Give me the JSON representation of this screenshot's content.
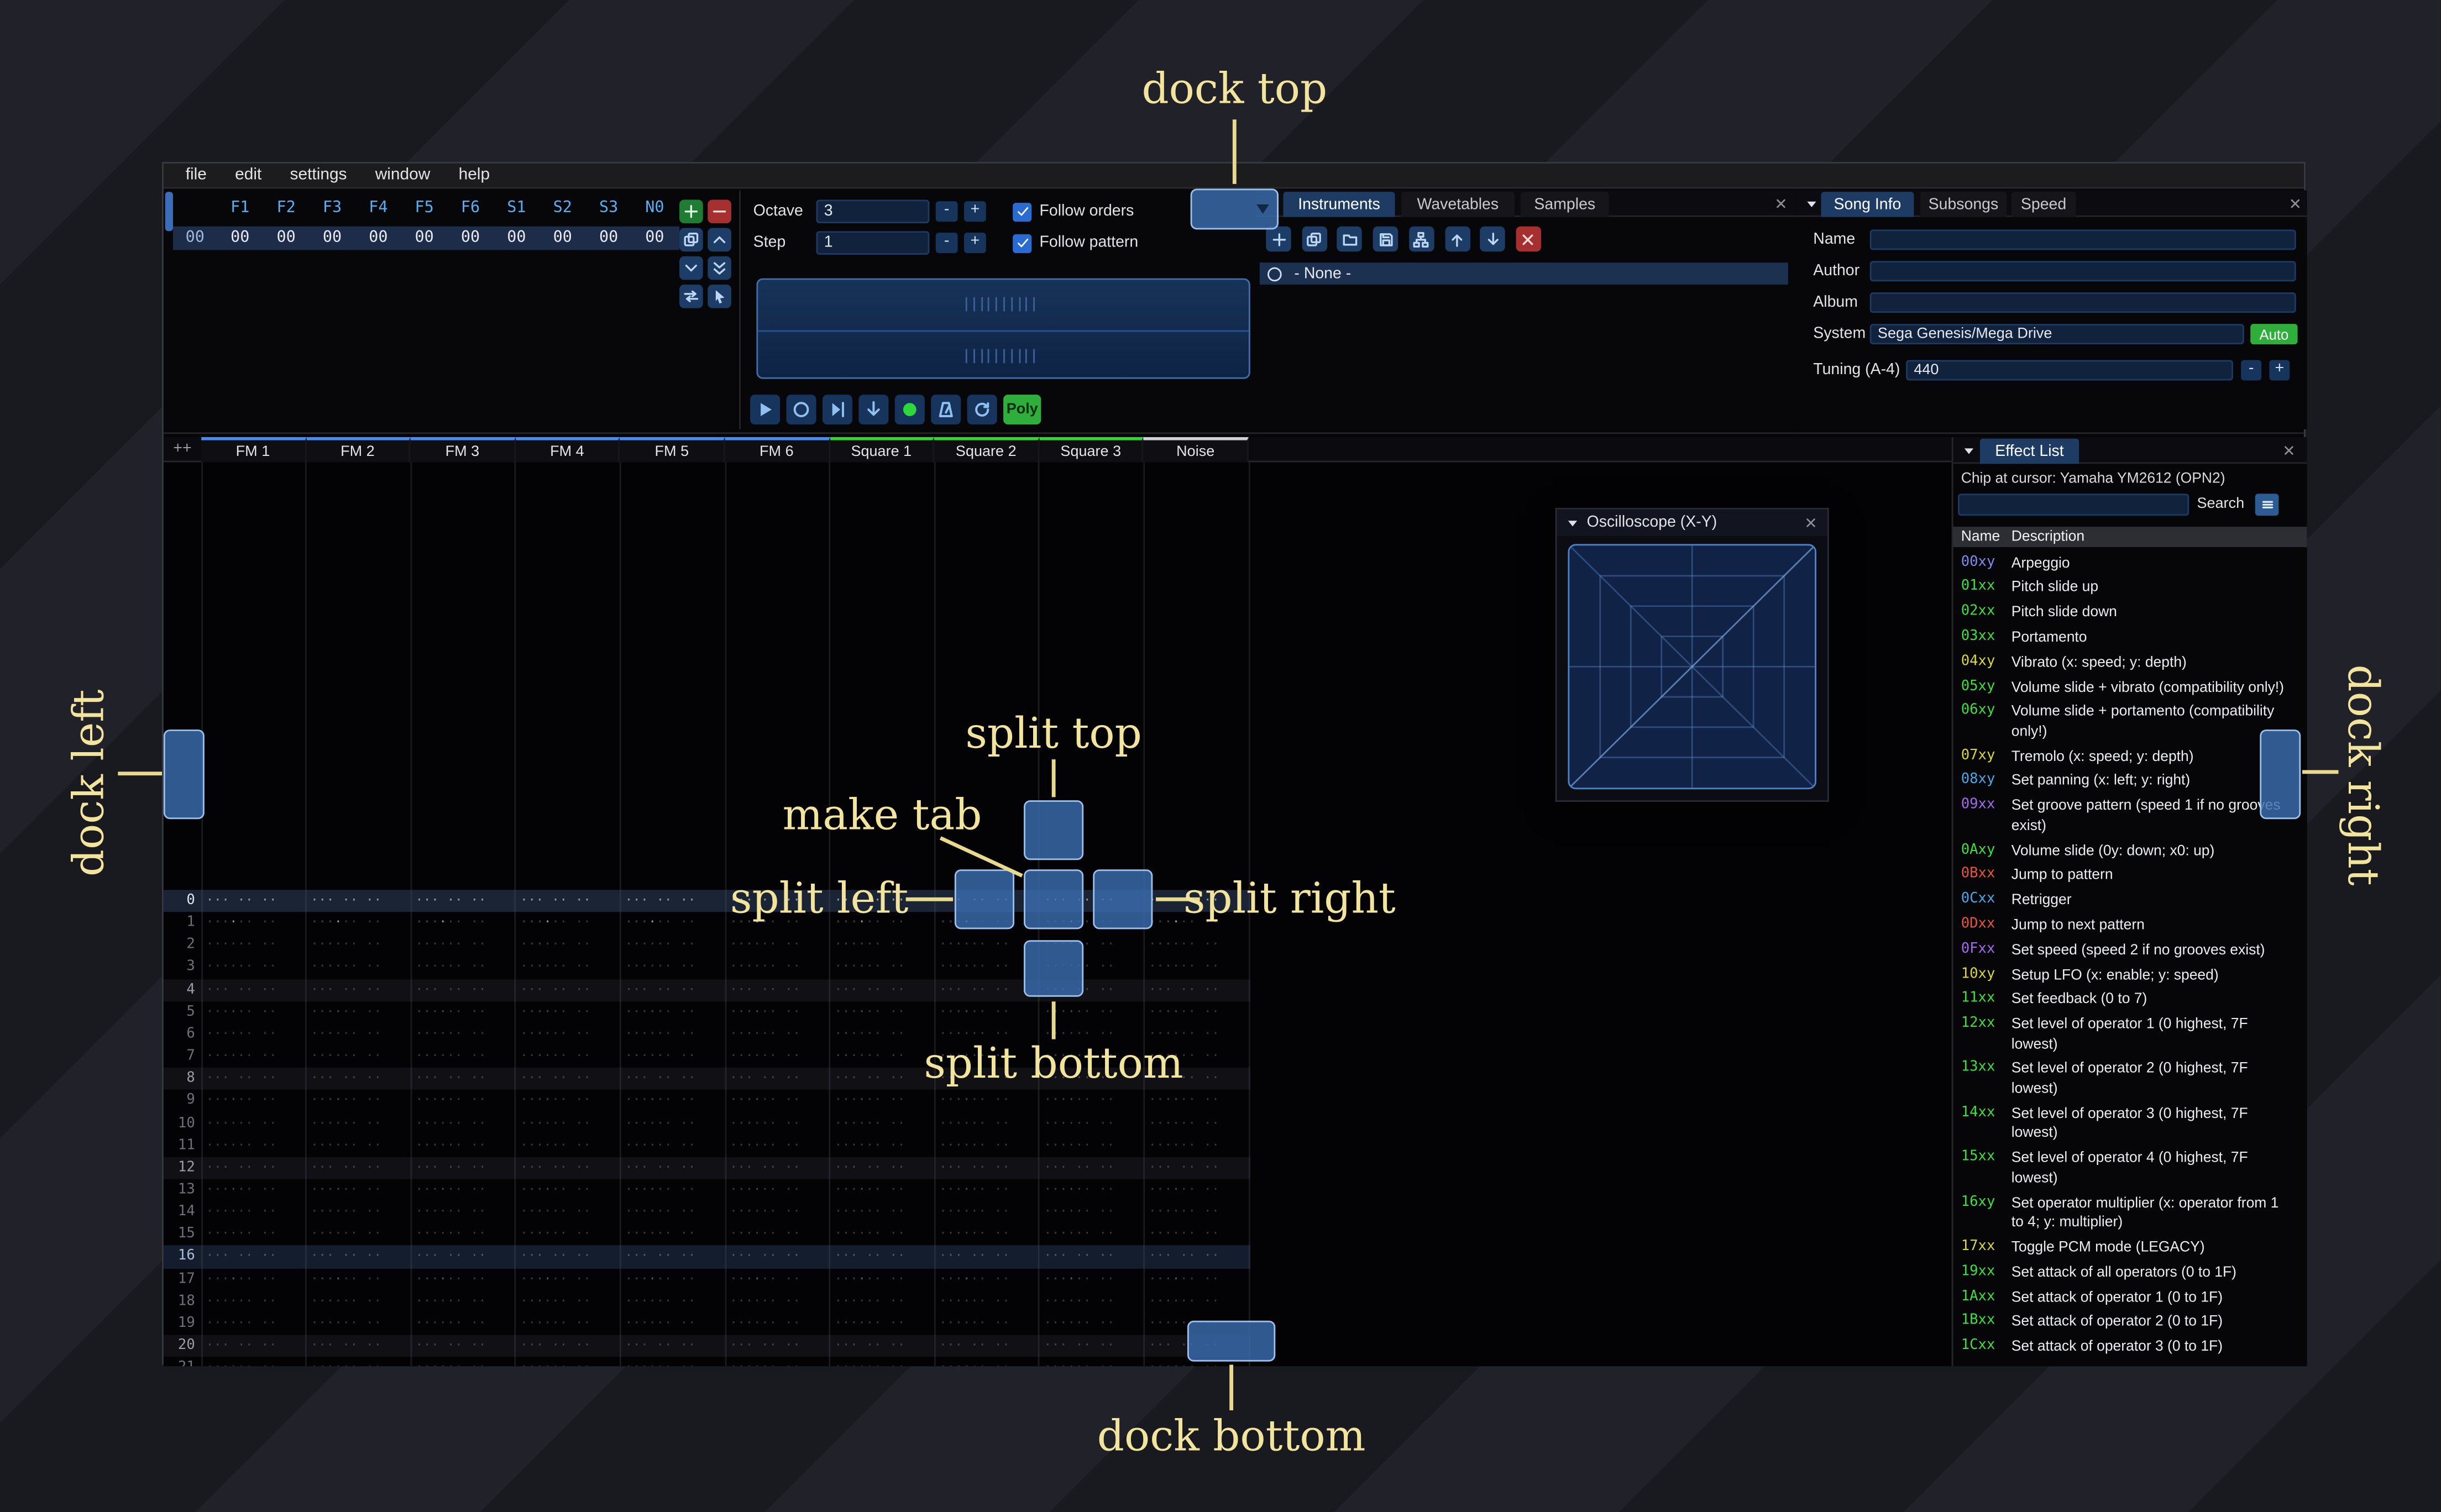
{
  "menu": [
    "file",
    "edit",
    "settings",
    "window",
    "help"
  ],
  "orders": {
    "channel_headers": [
      "F1",
      "F2",
      "F3",
      "F4",
      "F5",
      "F6",
      "S1",
      "S2",
      "S3",
      "N0"
    ],
    "rows": [
      {
        "index": "00",
        "values": [
          "00",
          "00",
          "00",
          "00",
          "00",
          "00",
          "00",
          "00",
          "00",
          "00"
        ]
      }
    ],
    "buttons": [
      {
        "name": "add-order",
        "icon": "plus",
        "style": "green"
      },
      {
        "name": "remove-order",
        "icon": "minus",
        "style": "red"
      },
      {
        "name": "duplicate-order",
        "icon": "copy",
        "style": "blue"
      },
      {
        "name": "move-order-up",
        "icon": "chevron-up",
        "style": "blue"
      },
      {
        "name": "move-order-down",
        "icon": "chevron-down",
        "style": "blue"
      },
      {
        "name": "duplicate-order-to-end",
        "icon": "double-chevron-down",
        "style": "blue"
      },
      {
        "name": "order-change-all",
        "icon": "swap",
        "style": "blue"
      },
      {
        "name": "order-edit-mode",
        "icon": "pointer",
        "style": "blue"
      }
    ]
  },
  "transport": {
    "octave_label": "Octave",
    "octave_value": "3",
    "step_label": "Step",
    "step_value": "1",
    "minus_label": "-",
    "plus_label": "+",
    "follow_orders_label": "Follow orders",
    "follow_pattern_label": "Follow pattern",
    "buttons": [
      {
        "name": "play",
        "icon": "play"
      },
      {
        "name": "play-pattern",
        "icon": "circle-play"
      },
      {
        "name": "play-from-cursor",
        "icon": "step"
      },
      {
        "name": "step-one-row",
        "icon": "arrow-down"
      },
      {
        "name": "edit-record-toggle",
        "icon": "record",
        "style": "record"
      },
      {
        "name": "metronome",
        "icon": "metronome"
      },
      {
        "name": "repeat-pattern",
        "icon": "loop"
      }
    ],
    "poly_label": "Poly"
  },
  "instruments": {
    "tabs": [
      {
        "label": "Instruments",
        "active": true
      },
      {
        "label": "Wavetables",
        "active": false
      },
      {
        "label": "Samples",
        "active": false
      }
    ],
    "toolbar": [
      {
        "name": "add-instrument",
        "icon": "plus",
        "style": "blue"
      },
      {
        "name": "duplicate-instrument",
        "icon": "copy",
        "style": "blue"
      },
      {
        "name": "open-instrument",
        "icon": "folder-open",
        "style": "blue"
      },
      {
        "name": "save-instrument",
        "icon": "save",
        "style": "blue"
      },
      {
        "name": "toggle-folders",
        "icon": "sitemap",
        "style": "blue"
      },
      {
        "name": "move-instrument-up",
        "icon": "arrow-up",
        "style": "blue"
      },
      {
        "name": "move-instrument-down",
        "icon": "arrow-down",
        "style": "blue"
      },
      {
        "name": "delete-instrument",
        "icon": "x",
        "style": "red"
      }
    ],
    "items": [
      {
        "label": "- None -",
        "selected": true
      }
    ]
  },
  "song_info": {
    "tabs": [
      {
        "label": "Song Info",
        "active": true
      },
      {
        "label": "Subsongs",
        "active": false
      },
      {
        "label": "Speed",
        "active": false
      }
    ],
    "fields": [
      {
        "label": "Name",
        "value": ""
      },
      {
        "label": "Author",
        "value": ""
      },
      {
        "label": "Album",
        "value": ""
      }
    ],
    "system_label": "System",
    "system_value": "Sega Genesis/Mega Drive",
    "auto_label": "Auto",
    "tuning_label": "Tuning (A-4)",
    "tuning_value": "440"
  },
  "pattern": {
    "expand_label": "++",
    "channels": [
      {
        "label": "FM 1",
        "type": "fm"
      },
      {
        "label": "FM 2",
        "type": "fm"
      },
      {
        "label": "FM 3",
        "type": "fm"
      },
      {
        "label": "FM 4",
        "type": "fm"
      },
      {
        "label": "FM 5",
        "type": "fm"
      },
      {
        "label": "FM 6",
        "type": "fm"
      },
      {
        "label": "Square 1",
        "type": "psg"
      },
      {
        "label": "Square 2",
        "type": "psg"
      },
      {
        "label": "Square 3",
        "type": "psg"
      },
      {
        "label": "Noise",
        "type": "noise"
      }
    ],
    "row_count": 22,
    "empty_cell": "··· ·· ·· ····"
  },
  "oscilloscope": {
    "title": "Oscilloscope (X-Y)"
  },
  "effect_list": {
    "tab_label": "Effect List",
    "chip_text": "Chip at cursor: Yamaha YM2612 (OPN2)",
    "search_label": "Search",
    "columns": {
      "name": "Name",
      "description": "Description"
    },
    "colors": {
      "green": "#3be03b",
      "yellow": "#d8d83a",
      "blue": "#8289f0",
      "lightblue": "#48a8e8",
      "violet": "#a569f0",
      "red": "#e8553a"
    },
    "effects": [
      {
        "code": "00xy",
        "color": "blue",
        "desc": "Arpeggio"
      },
      {
        "code": "01xx",
        "color": "green",
        "desc": "Pitch slide up"
      },
      {
        "code": "02xx",
        "color": "green",
        "desc": "Pitch slide down"
      },
      {
        "code": "03xx",
        "color": "green",
        "desc": "Portamento"
      },
      {
        "code": "04xy",
        "color": "yellow",
        "desc": "Vibrato (x: speed; y: depth)"
      },
      {
        "code": "05xy",
        "color": "green",
        "desc": "Volume slide + vibrato (compatibility only!)"
      },
      {
        "code": "06xy",
        "color": "green",
        "desc": "Volume slide + portamento (compatibility only!)"
      },
      {
        "code": "07xy",
        "color": "yellow",
        "desc": "Tremolo (x: speed; y: depth)"
      },
      {
        "code": "08xy",
        "color": "lightblue",
        "desc": "Set panning (x: left; y: right)"
      },
      {
        "code": "09xx",
        "color": "violet",
        "desc": "Set groove pattern (speed 1 if no grooves exist)"
      },
      {
        "code": "0Axy",
        "color": "green",
        "desc": "Volume slide (0y: down; x0: up)"
      },
      {
        "code": "0Bxx",
        "color": "red",
        "desc": "Jump to pattern"
      },
      {
        "code": "0Cxx",
        "color": "lightblue",
        "desc": "Retrigger"
      },
      {
        "code": "0Dxx",
        "color": "red",
        "desc": "Jump to next pattern"
      },
      {
        "code": "0Fxx",
        "color": "violet",
        "desc": "Set speed (speed 2 if no grooves exist)"
      },
      {
        "code": "10xy",
        "color": "yellow",
        "desc": "Setup LFO (x: enable; y: speed)"
      },
      {
        "code": "11xx",
        "color": "green",
        "desc": "Set feedback (0 to 7)"
      },
      {
        "code": "12xx",
        "color": "green",
        "desc": "Set level of operator 1 (0 highest, 7F lowest)"
      },
      {
        "code": "13xx",
        "color": "green",
        "desc": "Set level of operator 2 (0 highest, 7F lowest)"
      },
      {
        "code": "14xx",
        "color": "green",
        "desc": "Set level of operator 3 (0 highest, 7F lowest)"
      },
      {
        "code": "15xx",
        "color": "green",
        "desc": "Set level of operator 4 (0 highest, 7F lowest)"
      },
      {
        "code": "16xy",
        "color": "green",
        "desc": "Set operator multiplier (x: operator from 1 to 4; y: multiplier)"
      },
      {
        "code": "17xx",
        "color": "yellow",
        "desc": "Toggle PCM mode (LEGACY)"
      },
      {
        "code": "19xx",
        "color": "green",
        "desc": "Set attack of all operators (0 to 1F)"
      },
      {
        "code": "1Axx",
        "color": "green",
        "desc": "Set attack of operator 1 (0 to 1F)"
      },
      {
        "code": "1Bxx",
        "color": "green",
        "desc": "Set attack of operator 2 (0 to 1F)"
      },
      {
        "code": "1Cxx",
        "color": "green",
        "desc": "Set attack of operator 3 (0 to 1F)"
      }
    ]
  },
  "dock_overlay": {
    "dock_top": "dock top",
    "dock_bottom": "dock bottom",
    "dock_left": "dock left",
    "dock_right": "dock right",
    "split_top": "split top",
    "split_bottom": "split bottom",
    "split_left": "split left",
    "split_right": "split right",
    "make_tab": "make tab"
  }
}
